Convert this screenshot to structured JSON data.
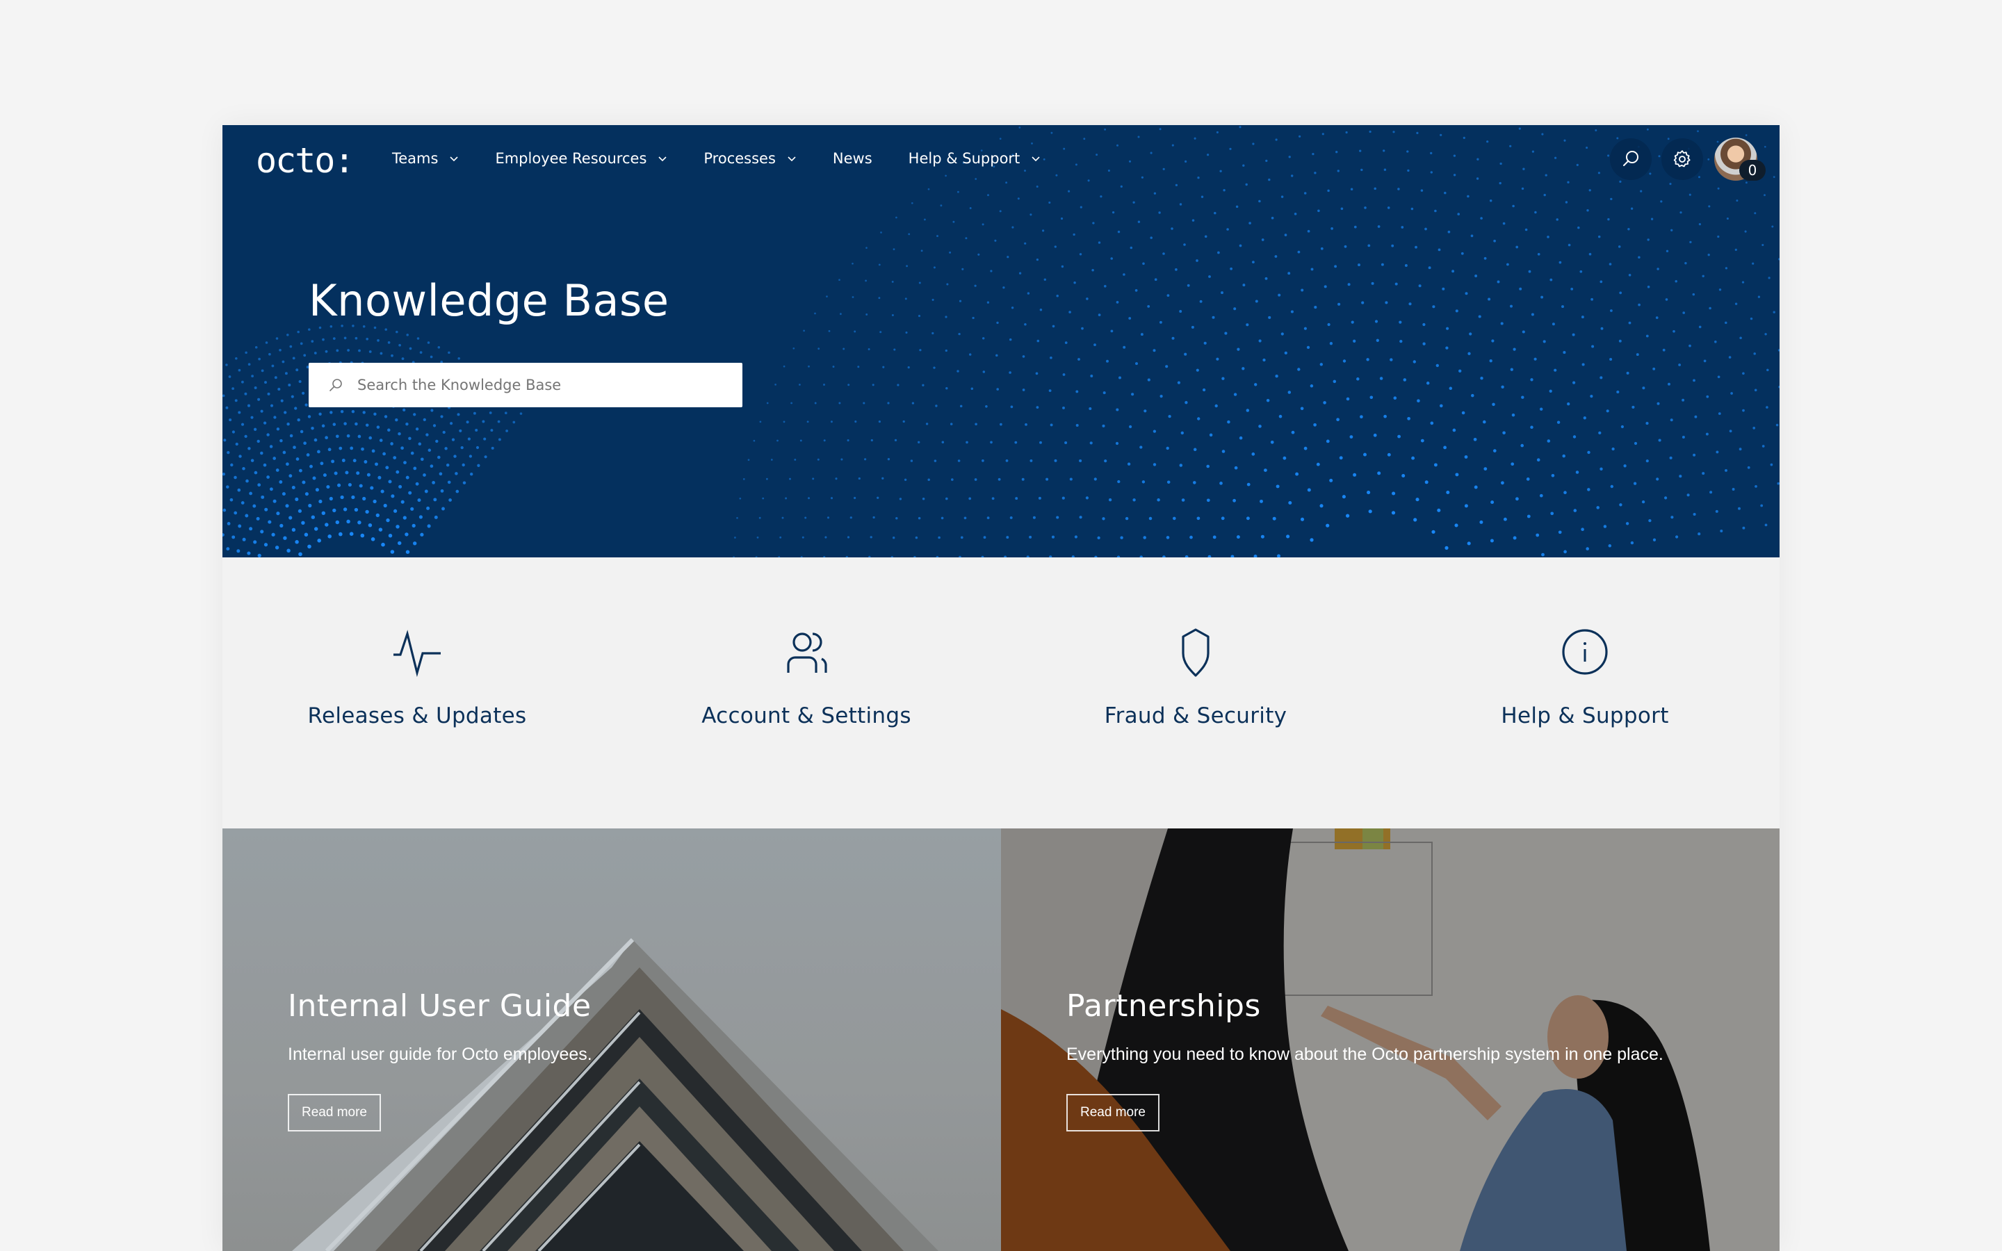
{
  "brand": {
    "logo_text": "octo:",
    "primary_color": "#04305e",
    "accent_dots_color": "#1a8cff",
    "text_dark": "#0c3159"
  },
  "nav": {
    "items": [
      {
        "label": "Teams",
        "has_dropdown": true
      },
      {
        "label": "Employee Resources",
        "has_dropdown": true
      },
      {
        "label": "Processes",
        "has_dropdown": true
      },
      {
        "label": "News",
        "has_dropdown": false
      },
      {
        "label": "Help & Support",
        "has_dropdown": true
      }
    ],
    "actions": {
      "search_icon": "search-icon",
      "settings_icon": "gear-icon",
      "notification_count": "0"
    }
  },
  "hero": {
    "title": "Knowledge Base",
    "search_placeholder": "Search the Knowledge Base"
  },
  "categories": [
    {
      "label": "Releases & Updates",
      "icon": "activity-icon"
    },
    {
      "label": "Account & Settings",
      "icon": "users-icon"
    },
    {
      "label": "Fraud & Security",
      "icon": "shield-icon"
    },
    {
      "label": "Help & Support",
      "icon": "info-icon"
    }
  ],
  "cards": [
    {
      "title": "Internal User Guide",
      "description": "Internal user guide for Octo employees.",
      "button_label": "Read more"
    },
    {
      "title": "Partnerships",
      "description": "Everything you need to know about the Octo partnership system in one place.",
      "button_label": "Read more"
    }
  ]
}
